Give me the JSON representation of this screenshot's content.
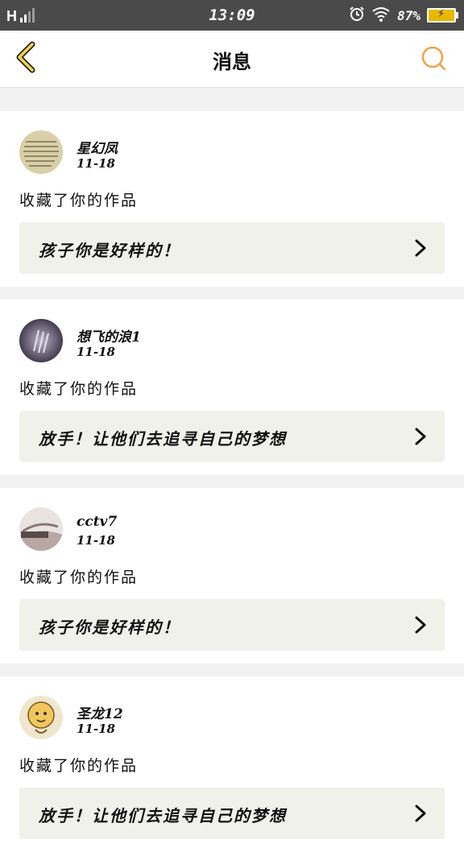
{
  "status_bar": {
    "network": "H",
    "time": "13:09",
    "battery_percent": "87%",
    "icons": [
      "signal-icon",
      "alarm-icon",
      "wifi-icon",
      "battery-icon"
    ]
  },
  "header": {
    "title": "消息",
    "back_icon": "chevron-left-icon",
    "search_icon": "search-icon"
  },
  "colors": {
    "accent_yellow": "#f2c21a",
    "search_orange": "#f0a24a",
    "box_bg": "#f1f1ec"
  },
  "messages": [
    {
      "username": "星幻凤",
      "date": "11-18",
      "action": "收藏了你的作品",
      "work_title": "孩子你是好样的！"
    },
    {
      "username": "想飞的浪1",
      "date": "11-18",
      "action": "收藏了你的作品",
      "work_title": "放手！让他们去追寻自己的梦想"
    },
    {
      "username": "cctv7",
      "date": "11-18",
      "action": "收藏了你的作品",
      "work_title": "孩子你是好样的！"
    },
    {
      "username": "圣龙12",
      "date": "11-18",
      "action": "收藏了你的作品",
      "work_title": "放手！让他们去追寻自己的梦想"
    }
  ]
}
